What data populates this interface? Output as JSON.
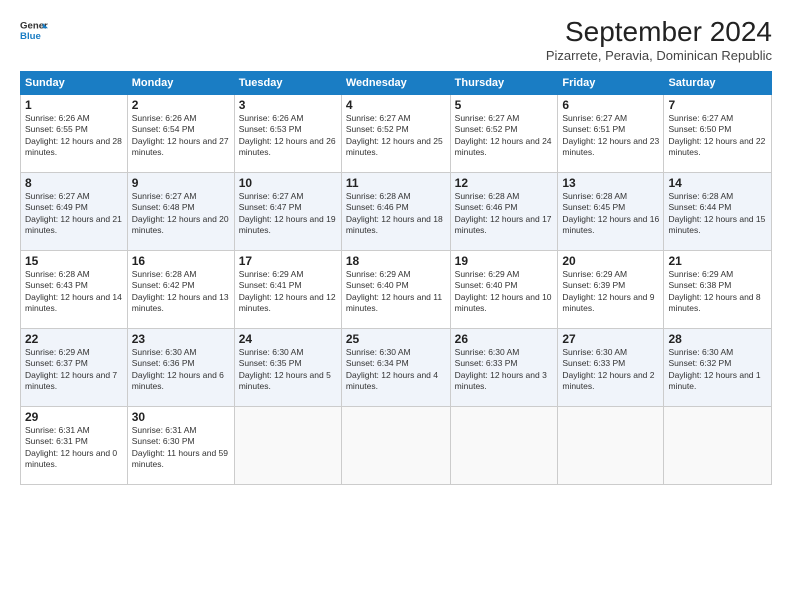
{
  "logo": {
    "line1": "General",
    "line2": "Blue"
  },
  "title": "September 2024",
  "subtitle": "Pizarrete, Peravia, Dominican Republic",
  "days_of_week": [
    "Sunday",
    "Monday",
    "Tuesday",
    "Wednesday",
    "Thursday",
    "Friday",
    "Saturday"
  ],
  "weeks": [
    [
      {
        "day": "1",
        "sunrise": "6:26 AM",
        "sunset": "6:55 PM",
        "daylight": "12 hours and 28 minutes."
      },
      {
        "day": "2",
        "sunrise": "6:26 AM",
        "sunset": "6:54 PM",
        "daylight": "12 hours and 27 minutes."
      },
      {
        "day": "3",
        "sunrise": "6:26 AM",
        "sunset": "6:53 PM",
        "daylight": "12 hours and 26 minutes."
      },
      {
        "day": "4",
        "sunrise": "6:27 AM",
        "sunset": "6:52 PM",
        "daylight": "12 hours and 25 minutes."
      },
      {
        "day": "5",
        "sunrise": "6:27 AM",
        "sunset": "6:52 PM",
        "daylight": "12 hours and 24 minutes."
      },
      {
        "day": "6",
        "sunrise": "6:27 AM",
        "sunset": "6:51 PM",
        "daylight": "12 hours and 23 minutes."
      },
      {
        "day": "7",
        "sunrise": "6:27 AM",
        "sunset": "6:50 PM",
        "daylight": "12 hours and 22 minutes."
      }
    ],
    [
      {
        "day": "8",
        "sunrise": "6:27 AM",
        "sunset": "6:49 PM",
        "daylight": "12 hours and 21 minutes."
      },
      {
        "day": "9",
        "sunrise": "6:27 AM",
        "sunset": "6:48 PM",
        "daylight": "12 hours and 20 minutes."
      },
      {
        "day": "10",
        "sunrise": "6:27 AM",
        "sunset": "6:47 PM",
        "daylight": "12 hours and 19 minutes."
      },
      {
        "day": "11",
        "sunrise": "6:28 AM",
        "sunset": "6:46 PM",
        "daylight": "12 hours and 18 minutes."
      },
      {
        "day": "12",
        "sunrise": "6:28 AM",
        "sunset": "6:46 PM",
        "daylight": "12 hours and 17 minutes."
      },
      {
        "day": "13",
        "sunrise": "6:28 AM",
        "sunset": "6:45 PM",
        "daylight": "12 hours and 16 minutes."
      },
      {
        "day": "14",
        "sunrise": "6:28 AM",
        "sunset": "6:44 PM",
        "daylight": "12 hours and 15 minutes."
      }
    ],
    [
      {
        "day": "15",
        "sunrise": "6:28 AM",
        "sunset": "6:43 PM",
        "daylight": "12 hours and 14 minutes."
      },
      {
        "day": "16",
        "sunrise": "6:28 AM",
        "sunset": "6:42 PM",
        "daylight": "12 hours and 13 minutes."
      },
      {
        "day": "17",
        "sunrise": "6:29 AM",
        "sunset": "6:41 PM",
        "daylight": "12 hours and 12 minutes."
      },
      {
        "day": "18",
        "sunrise": "6:29 AM",
        "sunset": "6:40 PM",
        "daylight": "12 hours and 11 minutes."
      },
      {
        "day": "19",
        "sunrise": "6:29 AM",
        "sunset": "6:40 PM",
        "daylight": "12 hours and 10 minutes."
      },
      {
        "day": "20",
        "sunrise": "6:29 AM",
        "sunset": "6:39 PM",
        "daylight": "12 hours and 9 minutes."
      },
      {
        "day": "21",
        "sunrise": "6:29 AM",
        "sunset": "6:38 PM",
        "daylight": "12 hours and 8 minutes."
      }
    ],
    [
      {
        "day": "22",
        "sunrise": "6:29 AM",
        "sunset": "6:37 PM",
        "daylight": "12 hours and 7 minutes."
      },
      {
        "day": "23",
        "sunrise": "6:30 AM",
        "sunset": "6:36 PM",
        "daylight": "12 hours and 6 minutes."
      },
      {
        "day": "24",
        "sunrise": "6:30 AM",
        "sunset": "6:35 PM",
        "daylight": "12 hours and 5 minutes."
      },
      {
        "day": "25",
        "sunrise": "6:30 AM",
        "sunset": "6:34 PM",
        "daylight": "12 hours and 4 minutes."
      },
      {
        "day": "26",
        "sunrise": "6:30 AM",
        "sunset": "6:33 PM",
        "daylight": "12 hours and 3 minutes."
      },
      {
        "day": "27",
        "sunrise": "6:30 AM",
        "sunset": "6:33 PM",
        "daylight": "12 hours and 2 minutes."
      },
      {
        "day": "28",
        "sunrise": "6:30 AM",
        "sunset": "6:32 PM",
        "daylight": "12 hours and 1 minute."
      }
    ],
    [
      {
        "day": "29",
        "sunrise": "6:31 AM",
        "sunset": "6:31 PM",
        "daylight": "12 hours and 0 minutes."
      },
      {
        "day": "30",
        "sunrise": "6:31 AM",
        "sunset": "6:30 PM",
        "daylight": "11 hours and 59 minutes."
      },
      null,
      null,
      null,
      null,
      null
    ]
  ]
}
